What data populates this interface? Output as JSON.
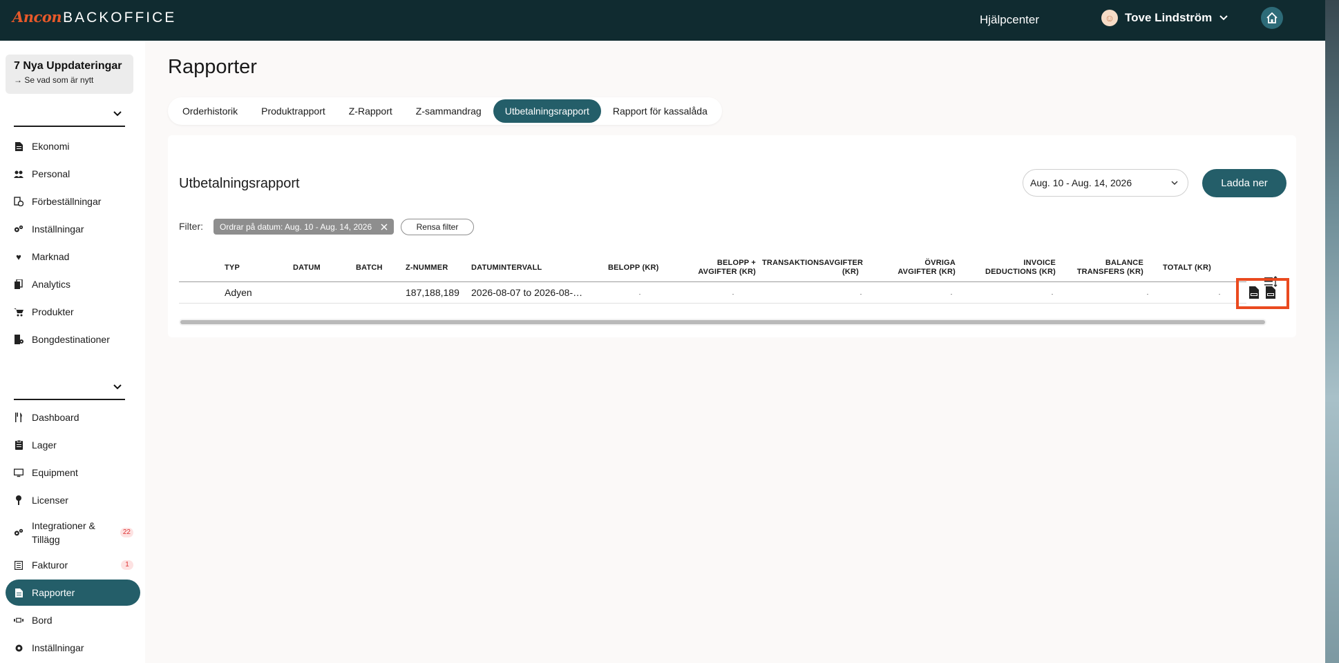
{
  "header": {
    "logo_brand": "Ancon",
    "logo_product": "BACKOFFICE",
    "help_center": "Hjälpcenter",
    "user_name": "Tove Lindström"
  },
  "sidebar": {
    "updates_title": "7 Nya Uppdateringar",
    "updates_subtitle": "→ Se vad som är nytt",
    "group1": [
      {
        "label": "Ekonomi",
        "icon": "document-icon"
      },
      {
        "label": "Personal",
        "icon": "people-icon"
      },
      {
        "label": "Förbeställningar",
        "icon": "preorder-icon"
      },
      {
        "label": "Inställningar",
        "icon": "gears-icon"
      },
      {
        "label": "Marknad",
        "icon": "heart-icon"
      },
      {
        "label": "Analytics",
        "icon": "copy-icon"
      },
      {
        "label": "Produkter",
        "icon": "cart-icon"
      },
      {
        "label": "Bongdestinationer",
        "icon": "receipt-icon"
      }
    ],
    "group2": [
      {
        "label": "Dashboard",
        "icon": "cutlery-icon"
      },
      {
        "label": "Lager",
        "icon": "clipboard-icon"
      },
      {
        "label": "Equipment",
        "icon": "monitor-icon"
      },
      {
        "label": "Licenser",
        "icon": "key-icon"
      },
      {
        "label": "Integrationer & Tillägg",
        "icon": "gears-icon",
        "badge": "22"
      },
      {
        "label": "Fakturor",
        "icon": "list-icon",
        "badge": "1"
      },
      {
        "label": "Rapporter",
        "icon": "document-icon",
        "active": true
      },
      {
        "label": "Bord",
        "icon": "table-icon"
      },
      {
        "label": "Inställningar",
        "icon": "gear-icon"
      }
    ]
  },
  "main": {
    "page_title": "Rapporter",
    "tabs": [
      "Orderhistorik",
      "Produktrapport",
      "Z-Rapport",
      "Z-sammandrag",
      "Utbetalningsrapport",
      "Rapport för kassalåda"
    ],
    "active_tab": "Utbetalningsrapport",
    "card_title": "Utbetalningsrapport",
    "date_range": "Aug. 10 - Aug. 14, 2026",
    "download_label": "Ladda ner",
    "filter_label": "Filter:",
    "filter_chip": "Ordrar på datum: Aug. 10 - Aug. 14, 2026",
    "clear_filter": "Rensa filter",
    "columns": {
      "typ": "TYP",
      "datum": "DATUM",
      "batch": "BATCH",
      "znummer": "Z-NUMMER",
      "datumintervall": "DATUMINTERVALL",
      "belopp": "BELOPP (KR)",
      "belopp_avg_1": "BELOPP +",
      "belopp_avg_2": "AVGIFTER (KR)",
      "trans_1": "TRANSAKTIONSAVGIFTER",
      "trans_2": "(KR)",
      "ovriga_1": "ÖVRIGA",
      "ovriga_2": "AVGIFTER (KR)",
      "invoice_1": "INVOICE",
      "invoice_2": "DEDUCTIONS (KR)",
      "balance_1": "BALANCE",
      "balance_2": "TRANSFERS (KR)",
      "totalt": "TOTALT (KR)"
    },
    "row": {
      "typ": "Adyen",
      "znummer": "187,188,189",
      "datumintervall": "2026-08-07 to 2026-08-…"
    }
  },
  "colors": {
    "topbar": "#102b30",
    "accent": "#245e69",
    "highlight": "#ea4a1f",
    "logo": "#e8592a"
  }
}
